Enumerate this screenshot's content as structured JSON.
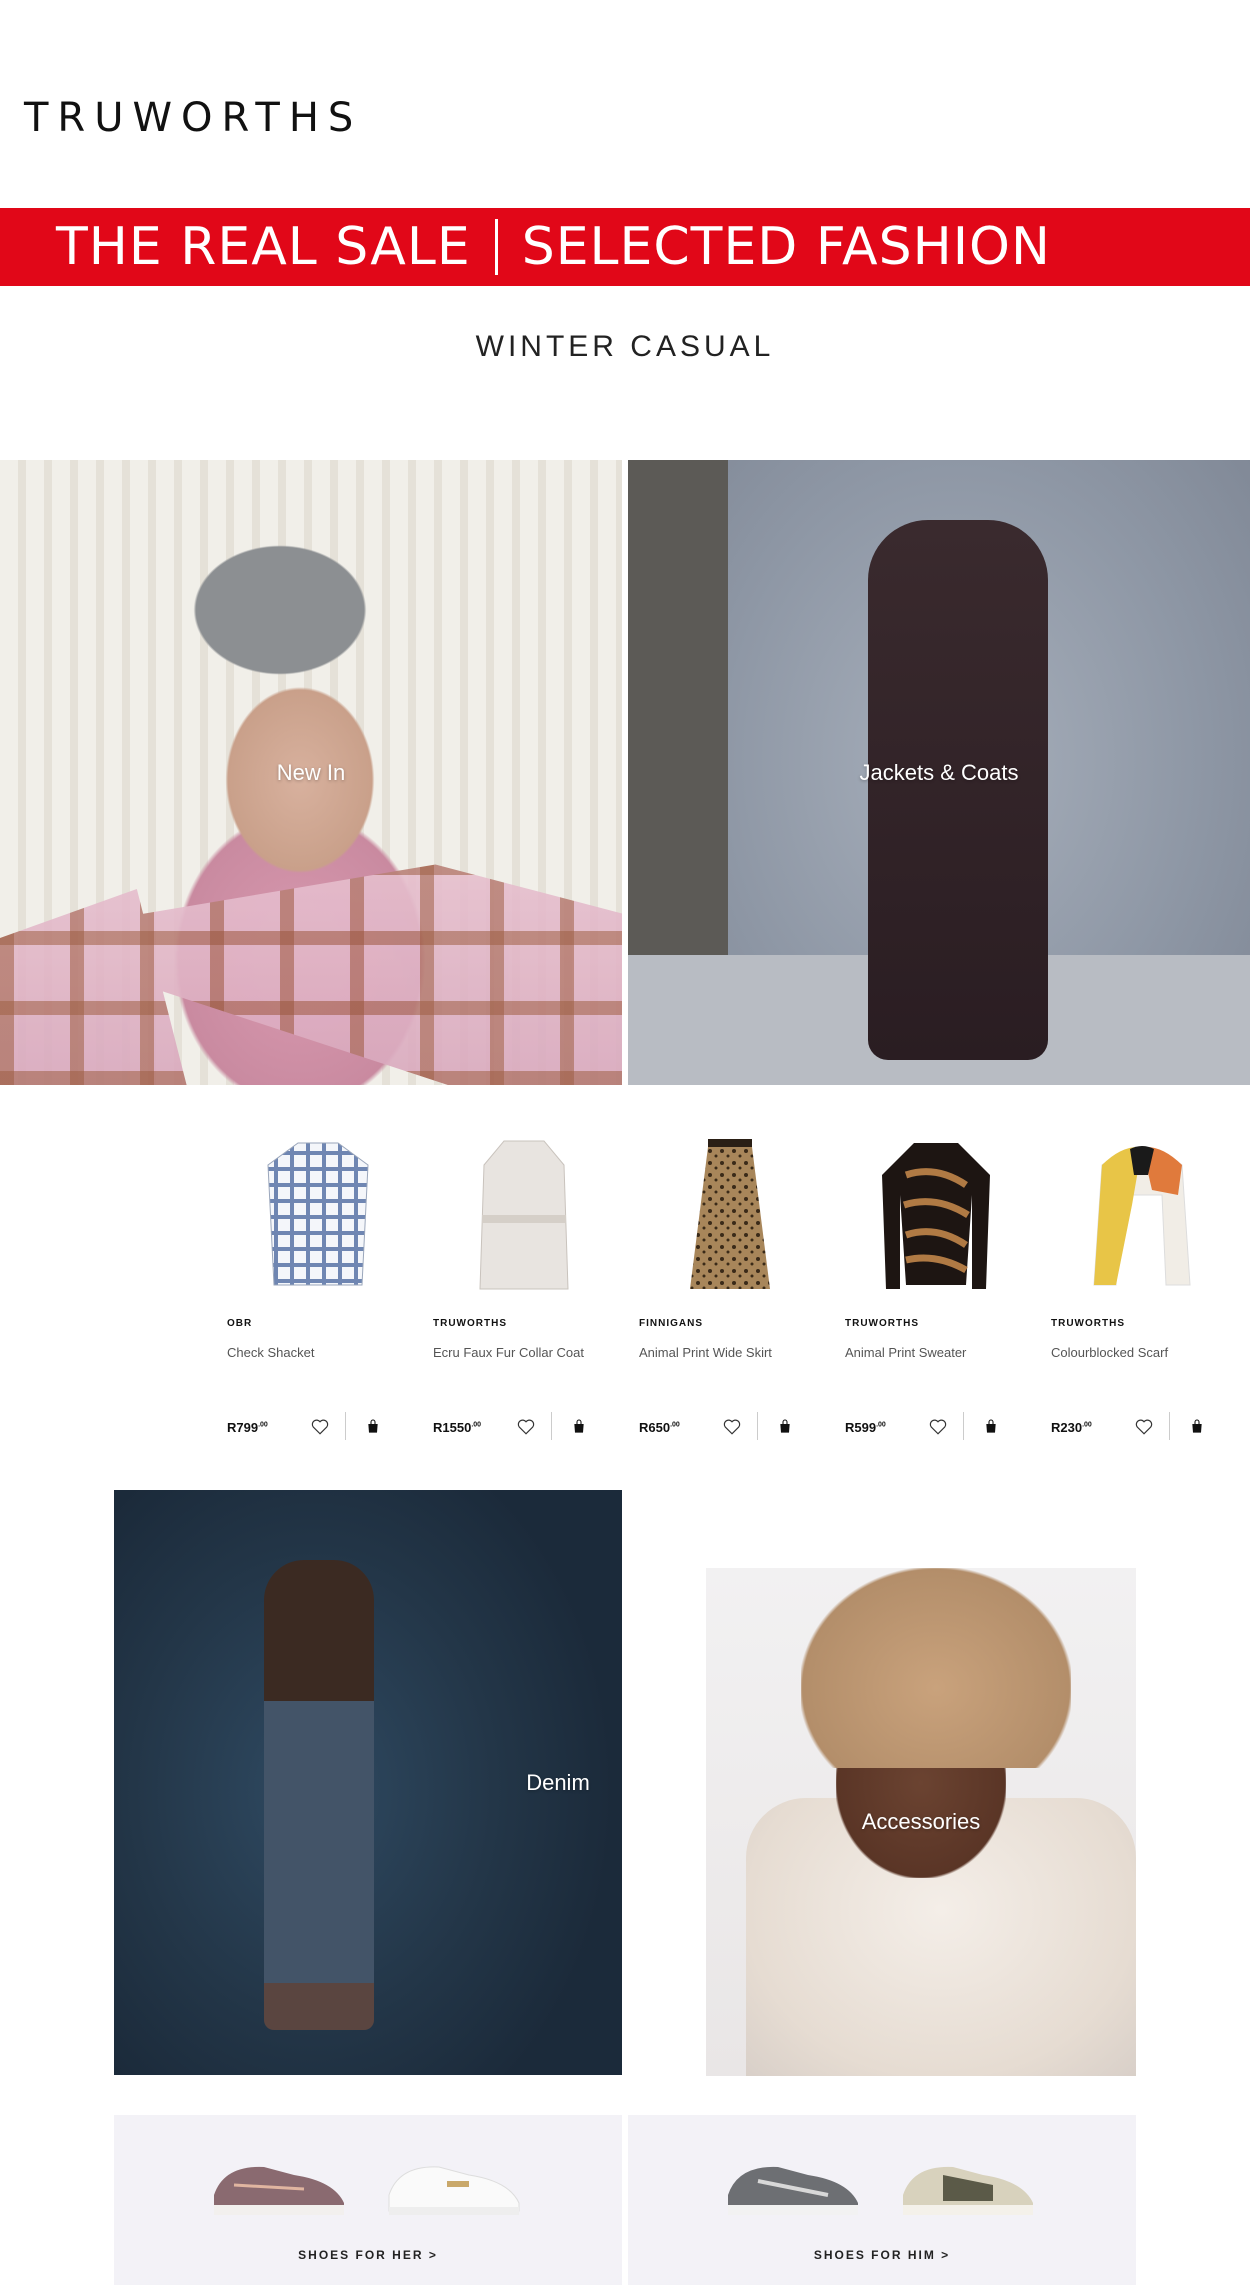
{
  "brand": {
    "logo": "TRUWORTHS"
  },
  "sale_banner": {
    "left": "THE REAL SALE",
    "right": "SELECTED FASHION",
    "color": "#e10718"
  },
  "section": {
    "title": "WINTER CASUAL"
  },
  "hero_tiles": [
    {
      "label": "New In"
    },
    {
      "label": "Jackets & Coats"
    }
  ],
  "products": [
    {
      "brand": "OBR",
      "name": "Check Shacket",
      "price": "R799",
      "cents": ".00",
      "icon": "plaid-shirt"
    },
    {
      "brand": "TRUWORTHS",
      "name": "Ecru Faux Fur Collar Coat",
      "price": "R1550",
      "cents": ".00",
      "icon": "coat"
    },
    {
      "brand": "FINNIGANS",
      "name": "Animal Print Wide Skirt",
      "price": "R650",
      "cents": ".00",
      "icon": "skirt"
    },
    {
      "brand": "TRUWORTHS",
      "name": "Animal Print Sweater",
      "price": "R599",
      "cents": ".00",
      "icon": "sweater"
    },
    {
      "brand": "TRUWORTHS",
      "name": "Colourblocked Scarf",
      "price": "R230",
      "cents": ".00",
      "icon": "scarf"
    }
  ],
  "feature_tiles": [
    {
      "label": "Denim"
    },
    {
      "label": "Accessories"
    }
  ],
  "shoes": [
    {
      "cta": "SHOES FOR HER >"
    },
    {
      "cta": "SHOES FOR HIM >"
    }
  ]
}
